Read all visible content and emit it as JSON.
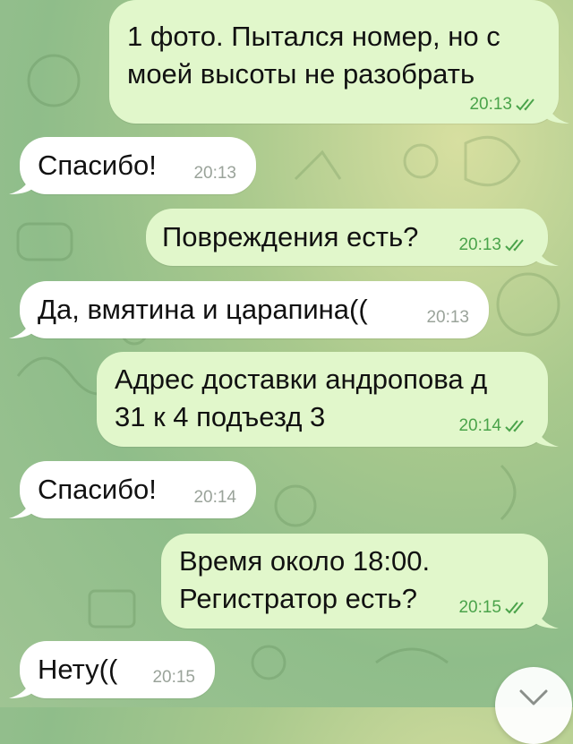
{
  "colors": {
    "outgoing_bubble": "#e1f7cb",
    "incoming_bubble": "#ffffff",
    "outgoing_meta": "#4aa34a",
    "incoming_meta": "#9aa39a"
  },
  "messages": [
    {
      "direction": "out",
      "text": "1 фото. Пытался номер, но с\nмоей высоты не разобрать",
      "time": "20:13",
      "status": "read-double-check-icon"
    },
    {
      "direction": "in",
      "text": "Спасибо!",
      "time": "20:13"
    },
    {
      "direction": "out",
      "text": "Повреждения есть?",
      "time": "20:13",
      "status": "read-double-check-icon"
    },
    {
      "direction": "in",
      "text": "Да, вмятина и царапина((",
      "time": "20:13"
    },
    {
      "direction": "out",
      "text": "Адрес доставки андропова д\n31 к 4 подъезд 3",
      "time": "20:14",
      "status": "read-double-check-icon"
    },
    {
      "direction": "in",
      "text": "Спасибо!",
      "time": "20:14"
    },
    {
      "direction": "out",
      "text": "Время около 18:00.\nРегистратор есть?",
      "time": "20:15",
      "status": "read-double-check-icon"
    },
    {
      "direction": "in",
      "text": "Нету((",
      "time": "20:15"
    }
  ],
  "scroll_button": {
    "icon": "chevron-down-icon"
  }
}
